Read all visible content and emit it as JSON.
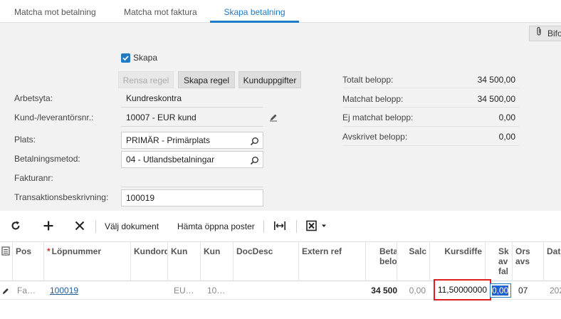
{
  "tabs": [
    {
      "label": "Matcha mot betalning"
    },
    {
      "label": "Matcha mot faktura"
    },
    {
      "label": "Skapa betalning"
    }
  ],
  "header": {
    "attach_label": "Bifo"
  },
  "form": {
    "skapa_label": "Skapa",
    "skapa_checked": true,
    "buttons": {
      "rensa": "Rensa regel",
      "skapa_regel": "Skapa regel",
      "kunduppgifter": "Kunduppgifter"
    },
    "fields": {
      "arbetsyta_label": "Arbetsyta:",
      "arbetsyta_value": "Kundreskontra",
      "kund_label": "Kund-/leverantörsnr.:",
      "kund_value": "10007 - EUR kund",
      "plats_label": "Plats:",
      "plats_value": "PRIMÄR - Primärplats",
      "betalningsmetod_label": "Betalningsmetod:",
      "betalningsmetod_value": "04 - Utlandsbetalningar",
      "fakturanr_label": "Fakturanr:",
      "fakturanr_value": "",
      "transaktion_label": "Transaktionsbeskrivning:",
      "transaktion_value": "100019"
    },
    "totals": {
      "totalt_label": "Totalt belopp:",
      "totalt_value": "34 500,00",
      "matchat_label": "Matchat belopp:",
      "matchat_value": "34 500,00",
      "ej_matchat_label": "Ej matchat belopp:",
      "ej_matchat_value": "0,00",
      "avskrivet_label": "Avskrivet belopp:",
      "avskrivet_value": "0,00"
    }
  },
  "toolbar": {
    "refresh_icon": "refresh-icon",
    "add_icon": "plus-icon",
    "delete_icon": "close-icon",
    "valj_dokument": "Välj dokument",
    "hamta_oppna_poster": "Hämta öppna poster",
    "fit_columns_icon": "fit-columns-icon",
    "export_icon": "excel-export-icon"
  },
  "grid": {
    "columns": {
      "pos": "Pos",
      "lopnummer": "Löpnummer",
      "kundord": "Kundord",
      "kun1": "Kun",
      "kun2": "Kun",
      "docdesc": "DocDesc",
      "externref": "Extern ref",
      "betalbelopp": "Beta belo",
      "saldo": "Salc",
      "kursdiff": "Kursdiffe",
      "skavfal": "Sk av fal",
      "orsavs": "Ors avs",
      "dat": "Dat"
    },
    "row": {
      "pos": "Fa…",
      "lopnummer": "100019",
      "kundord": "",
      "kun1": "EU…",
      "kun2": "10…",
      "docdesc": "",
      "externref": "",
      "betalbelopp": "34 500",
      "saldo": "0,00",
      "kursdiff": "11,50000000",
      "skavfal": "0,00",
      "orsavs": "07",
      "dat": "202"
    }
  },
  "colors": {
    "accent": "#1f7bc6",
    "error_outline": "#e02020"
  }
}
